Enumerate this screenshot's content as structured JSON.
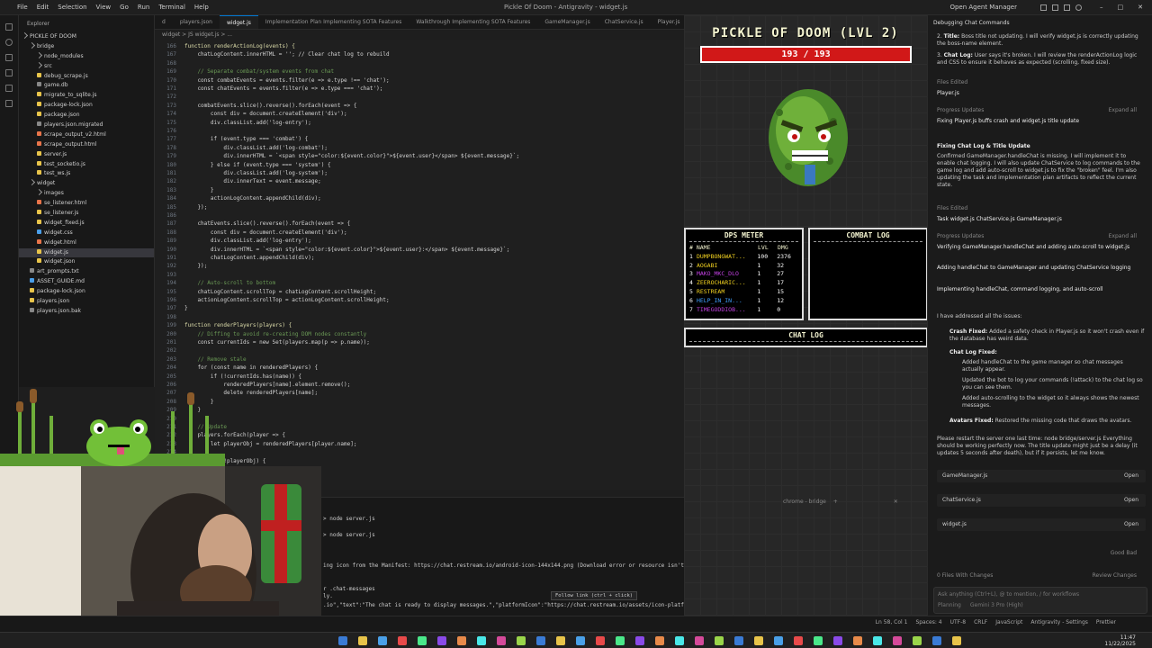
{
  "window": {
    "menu": [
      "File",
      "Edit",
      "Selection",
      "View",
      "Go",
      "Run",
      "Terminal",
      "Help"
    ],
    "title": "Pickle Of Doom - Antigravity - widget.js",
    "agent_manager": "Open Agent Manager"
  },
  "explorer": {
    "header": "Explorer",
    "project": "PICKLE OF DOOM",
    "items": [
      {
        "label": "bridge",
        "depth": 1,
        "folder": true
      },
      {
        "label": "node_modules",
        "depth": 2,
        "folder": true
      },
      {
        "label": "src",
        "depth": 2,
        "folder": true
      },
      {
        "label": "debug_scrape.js",
        "depth": 2,
        "color": "#e8c44a"
      },
      {
        "label": "game.db",
        "depth": 2,
        "color": "#888"
      },
      {
        "label": "migrate_to_sqlite.js",
        "depth": 2,
        "color": "#e8c44a"
      },
      {
        "label": "package-lock.json",
        "depth": 2,
        "color": "#e8c44a"
      },
      {
        "label": "package.json",
        "depth": 2,
        "color": "#e8c44a"
      },
      {
        "label": "players.json.migrated",
        "depth": 2,
        "color": "#888"
      },
      {
        "label": "scrape_output_v2.html",
        "depth": 2,
        "color": "#e8744a"
      },
      {
        "label": "scrape_output.html",
        "depth": 2,
        "color": "#e8744a"
      },
      {
        "label": "server.js",
        "depth": 2,
        "color": "#e8c44a"
      },
      {
        "label": "test_socketio.js",
        "depth": 2,
        "color": "#e8c44a"
      },
      {
        "label": "test_ws.js",
        "depth": 2,
        "color": "#e8c44a"
      },
      {
        "label": "widget",
        "depth": 1,
        "folder": true
      },
      {
        "label": "images",
        "depth": 2,
        "folder": true
      },
      {
        "label": "se_listener.html",
        "depth": 2,
        "color": "#e8744a"
      },
      {
        "label": "se_listener.js",
        "depth": 2,
        "color": "#e8c44a"
      },
      {
        "label": "widget_fixed.js",
        "depth": 2,
        "color": "#e8c44a"
      },
      {
        "label": "widget.css",
        "depth": 2,
        "color": "#4a9ee8"
      },
      {
        "label": "widget.html",
        "depth": 2,
        "color": "#e8744a"
      },
      {
        "label": "widget.js",
        "depth": 2,
        "color": "#e8c44a",
        "selected": true
      },
      {
        "label": "widget.json",
        "depth": 2,
        "color": "#e8c44a"
      },
      {
        "label": "art_prompts.txt",
        "depth": 1,
        "color": "#888"
      },
      {
        "label": "ASSET_GUIDE.md",
        "depth": 1,
        "color": "#4a9ee8"
      },
      {
        "label": "package-lock.json",
        "depth": 1,
        "color": "#e8c44a"
      },
      {
        "label": "players.json",
        "depth": 1,
        "color": "#e8c44a"
      },
      {
        "label": "players.json.bak",
        "depth": 1,
        "color": "#888"
      }
    ]
  },
  "tabs": [
    {
      "label": "d",
      "active": false
    },
    {
      "label": "players.json",
      "active": false
    },
    {
      "label": "widget.js",
      "active": true
    },
    {
      "label": "Implementation Plan  Implementing SOTA Features",
      "active": false
    },
    {
      "label": "Walkthrough  Implementing SOTA Features",
      "active": false
    },
    {
      "label": "GameManager.js",
      "active": false
    },
    {
      "label": "ChatService.js",
      "active": false
    },
    {
      "label": "Player.js",
      "active": false
    },
    {
      "label": "Gear.js",
      "active": false
    },
    {
      "label": "Task  Implementing SOTA Features",
      "active": false
    }
  ],
  "breadcrumb": "widget > JS widget.js > ...",
  "code_lines": [
    {
      "n": "166",
      "t": "function renderActionLog(events) {"
    },
    {
      "n": "167",
      "t": "    chatLogContent.innerHTML = ''; // Clear chat log to rebuild"
    },
    {
      "n": "168",
      "t": ""
    },
    {
      "n": "169",
      "t": "    // Separate combat/system events from chat"
    },
    {
      "n": "170",
      "t": "    const combatEvents = events.filter(e => e.type !== 'chat');"
    },
    {
      "n": "171",
      "t": "    const chatEvents = events.filter(e => e.type === 'chat');"
    },
    {
      "n": "172",
      "t": ""
    },
    {
      "n": "173",
      "t": "    combatEvents.slice().reverse().forEach(event => {"
    },
    {
      "n": "174",
      "t": "        const div = document.createElement('div');"
    },
    {
      "n": "175",
      "t": "        div.classList.add('log-entry');"
    },
    {
      "n": "176",
      "t": ""
    },
    {
      "n": "177",
      "t": "        if (event.type === 'combat') {"
    },
    {
      "n": "178",
      "t": "            div.classList.add('log-combat');"
    },
    {
      "n": "179",
      "t": "            div.innerHTML = `<span style=\"color:${event.color}\">${event.user}</span> ${event.message}`;"
    },
    {
      "n": "180",
      "t": "        } else if (event.type === 'system') {"
    },
    {
      "n": "181",
      "t": "            div.classList.add('log-system');"
    },
    {
      "n": "182",
      "t": "            div.innerText = event.message;"
    },
    {
      "n": "183",
      "t": "        }"
    },
    {
      "n": "184",
      "t": "        actionLogContent.appendChild(div);"
    },
    {
      "n": "185",
      "t": "    });"
    },
    {
      "n": "186",
      "t": ""
    },
    {
      "n": "187",
      "t": "    chatEvents.slice().reverse().forEach(event => {"
    },
    {
      "n": "188",
      "t": "        const div = document.createElement('div');"
    },
    {
      "n": "189",
      "t": "        div.classList.add('log-entry');"
    },
    {
      "n": "190",
      "t": "        div.innerHTML = `<span style=\"color:${event.color}\">${event.user}:</span> ${event.message}`;"
    },
    {
      "n": "191",
      "t": "        chatLogContent.appendChild(div);"
    },
    {
      "n": "192",
      "t": "    });"
    },
    {
      "n": "193",
      "t": ""
    },
    {
      "n": "194",
      "t": "    // Auto-scroll to bottom"
    },
    {
      "n": "195",
      "t": "    chatLogContent.scrollTop = chatLogContent.scrollHeight;"
    },
    {
      "n": "196",
      "t": "    actionLogContent.scrollTop = actionLogContent.scrollHeight;"
    },
    {
      "n": "197",
      "t": "}"
    },
    {
      "n": "198",
      "t": ""
    },
    {
      "n": "199",
      "t": "function renderPlayers(players) {"
    },
    {
      "n": "200",
      "t": "    // Diffing to avoid re-creating DOM nodes constantly"
    },
    {
      "n": "201",
      "t": "    const currentIds = new Set(players.map(p => p.name));"
    },
    {
      "n": "202",
      "t": ""
    },
    {
      "n": "203",
      "t": "    // Remove stale"
    },
    {
      "n": "204",
      "t": "    for (const name in renderedPlayers) {"
    },
    {
      "n": "205",
      "t": "        if (!currentIds.has(name)) {"
    },
    {
      "n": "206",
      "t": "            renderedPlayers[name].element.remove();"
    },
    {
      "n": "207",
      "t": "            delete renderedPlayers[name];"
    },
    {
      "n": "208",
      "t": "        }"
    },
    {
      "n": "209",
      "t": "    }"
    },
    {
      "n": "210",
      "t": ""
    },
    {
      "n": "211",
      "t": "    // Update"
    },
    {
      "n": "212",
      "t": "    players.forEach(player => {"
    },
    {
      "n": "213",
      "t": "        let playerObj = renderedPlayers[player.name];"
    },
    {
      "n": "214",
      "t": ""
    },
    {
      "n": "215",
      "t": "        if (!playerObj) {"
    }
  ],
  "terminal": {
    "lines": [
      "> node server.js",
      "> node server.js",
      "ing icon from the Manifest: https://chat.restream.io/android-icon-144x144.png (Download error or resource isn't a valid image)",
      "r  .chat-messages",
      "ly.",
      ".io\",\"text\":\"The chat is ready to display messages.\",\"platformIcon\":\"https://chat.restream.io/assets/icon-platform/restream-icon-black.svg\"}"
    ],
    "tooltip": "Follow link (ctrl + click)",
    "panel_label": "chrome - bridge"
  },
  "game": {
    "title": "PICKLE OF DOOM (LVL 2)",
    "hp_text": "193 / 193",
    "hp_fraction": 1.0,
    "dps": {
      "title": "DPS METER",
      "headers": [
        "# NAME",
        "LVL",
        "DMG"
      ],
      "rows": [
        {
          "rank": "1",
          "name": "DUMPBONGWAT...",
          "lvl": "100",
          "dmg": "2376",
          "color": "#f0d020"
        },
        {
          "rank": "2",
          "name": "AOGABI",
          "lvl": "1",
          "dmg": "32",
          "color": "#f0d020"
        },
        {
          "rank": "3",
          "name": "MAKO_MKC_DLO",
          "lvl": "1",
          "dmg": "27",
          "color": "#c040e0"
        },
        {
          "rank": "4",
          "name": "ZEEROCHARIC...",
          "lvl": "1",
          "dmg": "17",
          "color": "#f0d020"
        },
        {
          "rank": "5",
          "name": "RESTREAM",
          "lvl": "1",
          "dmg": "15",
          "color": "#f0d020"
        },
        {
          "rank": "6",
          "name": "HELP_IN_IN...",
          "lvl": "1",
          "dmg": "12",
          "color": "#40a0ff"
        },
        {
          "rank": "7",
          "name": "TIMEGODDIOB...",
          "lvl": "1",
          "dmg": "0",
          "color": "#c040e0"
        }
      ]
    },
    "combat_title": "COMBAT LOG",
    "chat_title": "CHAT LOG"
  },
  "agent": {
    "header": "Debugging Chat Commands",
    "item2_title": "Title:",
    "item2_text": "Boss title not updating. I will verify widget.js is correctly updating the boss-name element.",
    "item3_title": "Chat Log:",
    "item3_text": "User says it's broken. I will review the renderActionLog logic and CSS to ensure it behaves as expected (scrolling, fixed size).",
    "files_edited": "Files Edited",
    "file_player": "Player.js",
    "progress": "Progress Updates",
    "expand": "Expand all",
    "progress1": "Fixing Player.js buffs crash and widget.js title update",
    "section_title": "Fixing Chat Log & Title Update",
    "section_text": "Confirmed GameManager.handleChat is missing. I will implement it to enable chat logging. I will also update ChatService to log commands to the game log and add auto-scroll to widget.js to fix the \"broken\" feel. I'm also updating the task and implementation plan artifacts to reflect the current state.",
    "files_edited2": "Files Edited",
    "files_list": "Task  widget.js  ChatService.js  GameManager.js",
    "progress2": "Progress Updates",
    "p2a": "Verifying GameManager.handleChat and adding auto-scroll to widget.js",
    "p2b": "Adding handleChat to GameManager and updating ChatService logging",
    "p2c": "Implementing handleChat, command logging, and auto-scroll",
    "summary_intro": "I have addressed all the issues:",
    "s1_title": "Crash Fixed:",
    "s1_text": "Added a safety check in Player.js so it won't crash even if the database has weird data.",
    "s2_title": "Chat Log Fixed:",
    "s2a": "Added handleChat to the game manager so chat messages actually appear.",
    "s2b": "Updated the bot to log your commands (!attack) to the chat log so you can see them.",
    "s2c": "Added auto-scrolling to the widget so it always shows the newest messages.",
    "s3_title": "Avatars Fixed:",
    "s3_text": "Restored the missing code that draws the avatars.",
    "restart_text": "Please restart the server one last time: node bridge/server.js Everything should be working perfectly now. The title update might just be a delay (it updates 5 seconds after death), but if it persists, let me know.",
    "cards": [
      "GameManager.js",
      "ChatService.js",
      "widget.js"
    ],
    "open_label": "Open",
    "feedback": "Good  Bad",
    "files_changes": "0 Files With Changes",
    "review": "Review Changes",
    "input_placeholder": "Ask anything (Ctrl+L), @ to mention, / for workflows",
    "mode": "Planning",
    "model": "Gemini 3 Pro (High)"
  },
  "statusbar": {
    "items": [
      "Ln 58, Col 1",
      "Spaces: 4",
      "UTF-8",
      "CRLF",
      "JavaScript",
      "Antigravity - Settings",
      "Prettier"
    ]
  },
  "taskbar": {
    "time": "11:47",
    "date": "11/22/2025"
  }
}
